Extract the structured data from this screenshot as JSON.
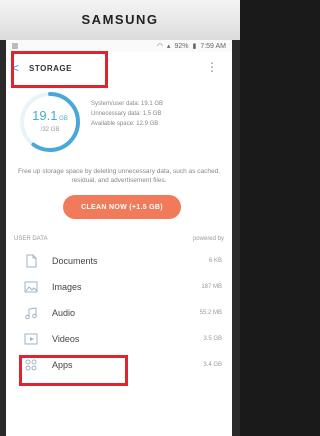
{
  "device": {
    "brand": "SAMSUNG"
  },
  "status_bar": {
    "battery": "92%",
    "time": "7:59 AM"
  },
  "app_bar": {
    "title": "STORAGE"
  },
  "summary": {
    "used_value": "19.1",
    "used_unit": "GB",
    "total": "/32 GB",
    "stats": [
      "System/user data: 19.1 GB",
      "Unnecessary data: 1.5 GB",
      "Available space: 12.9 GB"
    ],
    "used_fraction": 0.6,
    "description": "Free up storage space by deleting unnecessary data, such as cached, residual, and advertisement files."
  },
  "actions": {
    "clean_now_label": "CLEAN NOW (+1.5 GB)"
  },
  "user_data": {
    "header": "USER DATA",
    "powered_by": "powered by",
    "items": [
      {
        "label": "Documents",
        "size": "6 KB",
        "icon": "document-icon"
      },
      {
        "label": "Images",
        "size": "187 MB",
        "icon": "image-icon"
      },
      {
        "label": "Audio",
        "size": "55.2 MB",
        "icon": "audio-icon"
      },
      {
        "label": "Videos",
        "size": "3.5 GB",
        "icon": "video-icon"
      },
      {
        "label": "Apps",
        "size": "3.4 GB",
        "icon": "apps-icon"
      }
    ]
  },
  "colors": {
    "accent": "#f07a5a",
    "ring": "#4aa8d8",
    "highlight": "#e0242e"
  }
}
